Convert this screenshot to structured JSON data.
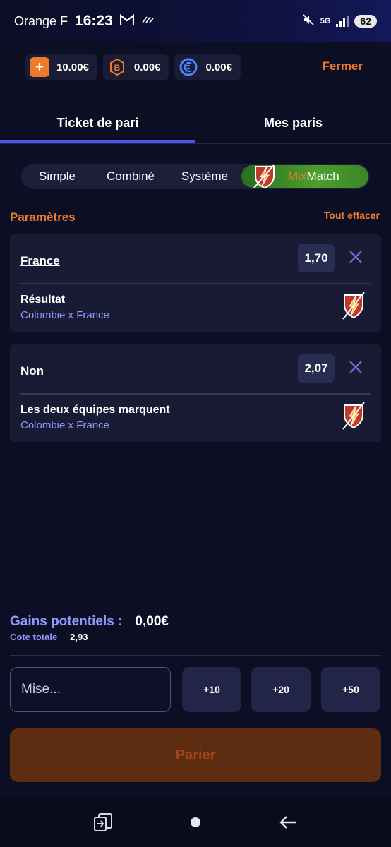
{
  "status_bar": {
    "carrier": "Orange F",
    "time": "16:23",
    "network": "5G",
    "battery": "62"
  },
  "wallet": {
    "main_balance": "10.00€",
    "bonus_balance": "0.00€",
    "cash_balance": "0.00€",
    "close_label": "Fermer"
  },
  "tabs": [
    {
      "label": "Ticket de pari",
      "active": true
    },
    {
      "label": "Mes paris",
      "active": false
    }
  ],
  "bet_types": {
    "simple": "Simple",
    "combine": "Combiné",
    "systeme": "Système",
    "mix_a": "Mix",
    "mix_b": "Match",
    "selected": "MixMatch"
  },
  "params": {
    "title": "Paramètres",
    "clear_all": "Tout effacer"
  },
  "selections": [
    {
      "pick": "France",
      "odds": "1,70",
      "market": "Résultat",
      "match": "Colombie x France"
    },
    {
      "pick": "Non",
      "odds": "2,07",
      "market": "Les deux équipes marquent",
      "match": "Colombie x France"
    }
  ],
  "totals": {
    "gains_label": "Gains potentiels :",
    "gains_value": "0,00€",
    "cote_label": "Cote totale",
    "cote_value": "2,93"
  },
  "stake": {
    "placeholder": "Mise...",
    "quick_10": "+10",
    "quick_20": "+20",
    "quick_50": "+50",
    "place_label": "Parier"
  },
  "colors": {
    "accent": "#f07a28",
    "tab_indicator": "#4a56e8",
    "link_blue": "#8f98ff",
    "background": "#0c0e24",
    "card": "#191b35"
  }
}
